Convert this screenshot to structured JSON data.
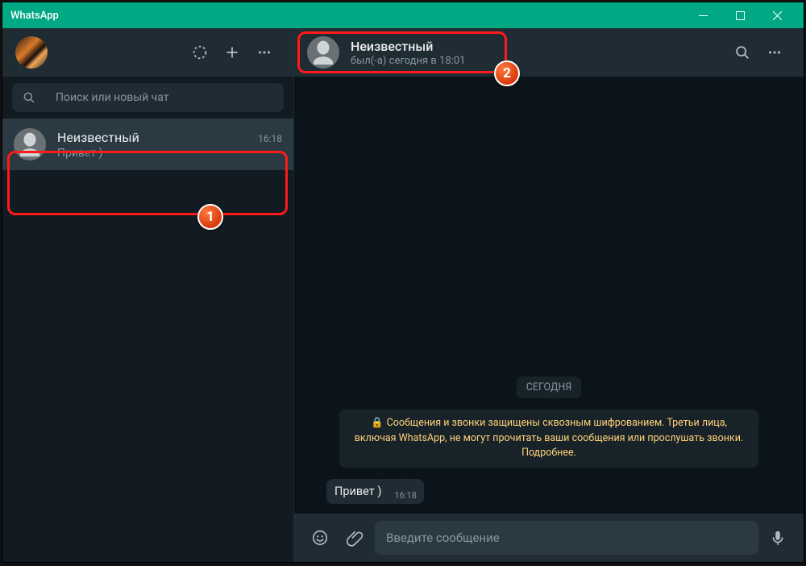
{
  "app": {
    "title": "WhatsApp"
  },
  "sidebar": {
    "search_placeholder": "Поиск или новый чат",
    "chats": [
      {
        "name": "Неизвестный",
        "preview": "Привет )",
        "time": "16:18"
      }
    ]
  },
  "chat": {
    "header": {
      "name": "Неизвестный",
      "status": "был(-а) сегодня в 18:01"
    },
    "date_label": "СЕГОДНЯ",
    "encryption_notice": "Сообщения и звонки защищены сквозным шифрованием. Третьи лица, включая WhatsApp, не могут прочитать ваши сообщения или прослушать звонки. Подробнее.",
    "messages": [
      {
        "text": "Привет )",
        "time": "16:18",
        "direction": "in"
      }
    ],
    "composer_placeholder": "Введите сообщение"
  },
  "annotations": {
    "badge1": "1",
    "badge2": "2"
  }
}
